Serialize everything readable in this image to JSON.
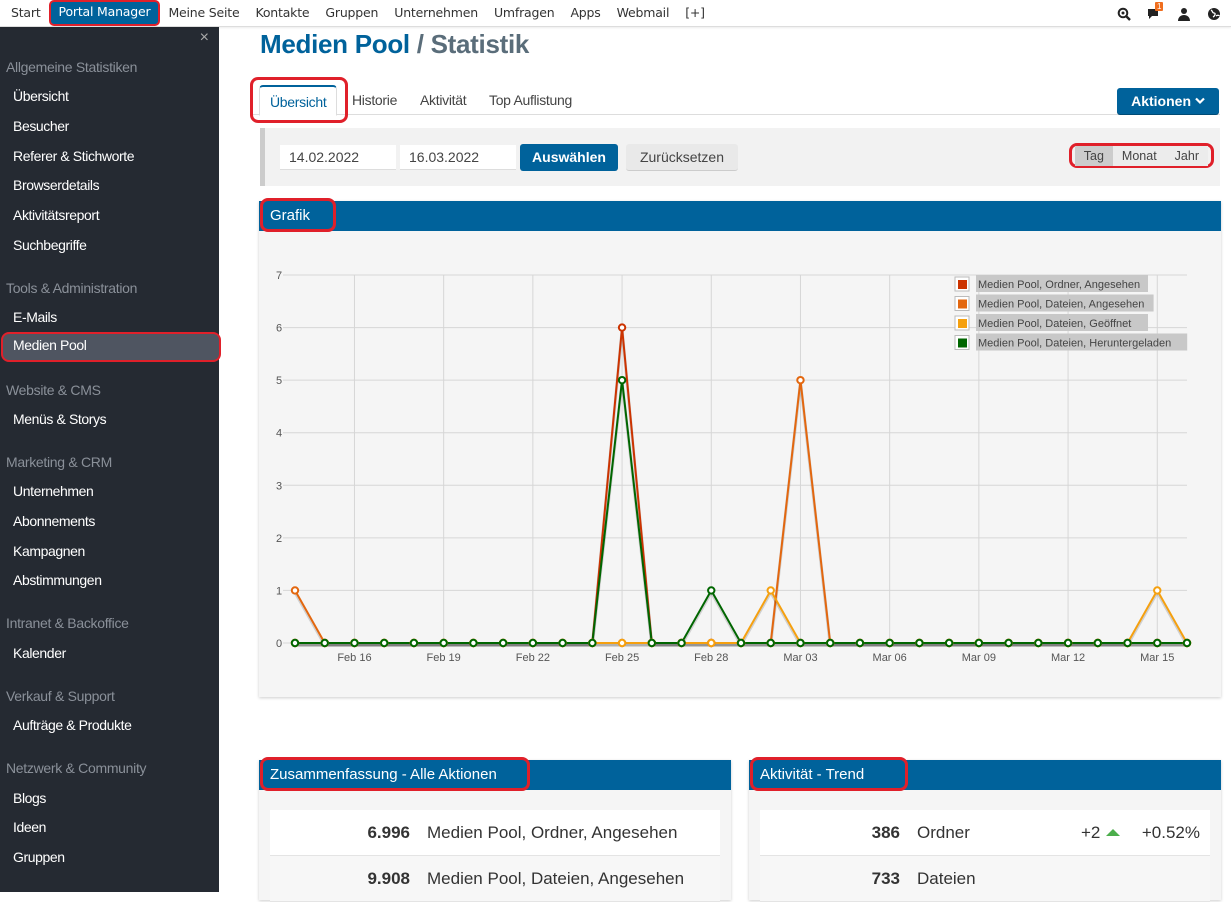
{
  "topnav": {
    "items": [
      "Start",
      "Portal Manager",
      "Meine Seite",
      "Kontakte",
      "Gruppen",
      "Unternehmen",
      "Umfragen",
      "Apps",
      "Webmail",
      "[+]"
    ],
    "active_index": 1,
    "notification_count": "1",
    "icons": [
      "zoom-search-icon",
      "chat-bubble-icon",
      "user-icon",
      "globe-icon"
    ]
  },
  "sidebar": {
    "close_label": "×",
    "groups": [
      {
        "title": "Allgemeine Statistiken",
        "items": [
          "Übersicht",
          "Besucher",
          "Referer & Stichworte",
          "Browserdetails",
          "Aktivitätsreport",
          "Suchbegriffe"
        ]
      },
      {
        "title": "Tools & Administration",
        "items": [
          "E-Mails",
          "Medien Pool"
        ]
      },
      {
        "title": "Website & CMS",
        "items": [
          "Menüs & Storys"
        ]
      },
      {
        "title": "Marketing & CRM",
        "items": [
          "Unternehmen",
          "Abonnements",
          "Kampagnen",
          "Abstimmungen"
        ]
      },
      {
        "title": "Intranet & Backoffice",
        "items": [
          "Kalender"
        ]
      },
      {
        "title": "Verkauf & Support",
        "items": [
          "Aufträge & Produkte"
        ]
      },
      {
        "title": "Netzwerk & Community",
        "items": [
          "Blogs",
          "Ideen",
          "Gruppen"
        ]
      }
    ],
    "active_item": "Medien Pool"
  },
  "page": {
    "title_main": "Medien Pool",
    "title_sep": " / ",
    "title_sub": "Statistik",
    "tabs": [
      "Übersicht",
      "Historie",
      "Aktivität",
      "Top Auflistung"
    ],
    "active_tab": "Übersicht",
    "actions_label": "Aktionen",
    "actions_icon": "chevron-down-icon"
  },
  "filter": {
    "date_from": "14.02.2022",
    "date_to": "16.03.2022",
    "select_label": "Auswählen",
    "reset_label": "Zurücksetzen",
    "periods": [
      "Tag",
      "Monat",
      "Jahr"
    ],
    "active_period": "Tag"
  },
  "chart_panel": {
    "title": "Grafik"
  },
  "chart_data": {
    "type": "line",
    "title": "",
    "xlabel": "",
    "ylabel": "",
    "ylim": [
      0,
      7
    ],
    "yticks": [
      0,
      1,
      2,
      3,
      4,
      5,
      6,
      7
    ],
    "grid": true,
    "legend_position": "top-right",
    "x": [
      "Feb 14",
      "Feb 15",
      "Feb 16",
      "Feb 17",
      "Feb 18",
      "Feb 19",
      "Feb 20",
      "Feb 21",
      "Feb 22",
      "Feb 23",
      "Feb 24",
      "Feb 25",
      "Feb 26",
      "Feb 27",
      "Feb 28",
      "Mar 01",
      "Mar 02",
      "Mar 03",
      "Mar 04",
      "Mar 05",
      "Mar 06",
      "Mar 07",
      "Mar 08",
      "Mar 09",
      "Mar 10",
      "Mar 11",
      "Mar 12",
      "Mar 13",
      "Mar 14",
      "Mar 15",
      "Mar 16"
    ],
    "xtick_labels": [
      "Feb 16",
      "Feb 19",
      "Feb 22",
      "Feb 25",
      "Feb 28",
      "Mar 03",
      "Mar 06",
      "Mar 09",
      "Mar 12",
      "Mar 15"
    ],
    "series": [
      {
        "name": "Medien Pool, Ordner, Angesehen",
        "color": "#cc3300",
        "values": [
          0,
          0,
          0,
          0,
          0,
          0,
          0,
          0,
          0,
          0,
          0,
          6,
          0,
          0,
          0,
          0,
          0,
          0,
          0,
          0,
          0,
          0,
          0,
          0,
          0,
          0,
          0,
          0,
          0,
          0,
          0
        ]
      },
      {
        "name": "Medien Pool, Dateien, Angesehen",
        "color": "#e3670f",
        "values": [
          1,
          0,
          0,
          0,
          0,
          0,
          0,
          0,
          0,
          0,
          0,
          0,
          0,
          0,
          0,
          0,
          0,
          5,
          0,
          0,
          0,
          0,
          0,
          0,
          0,
          0,
          0,
          0,
          0,
          0,
          0
        ]
      },
      {
        "name": "Medien Pool, Dateien, Geöffnet",
        "color": "#f5a00f",
        "values": [
          0,
          0,
          0,
          0,
          0,
          0,
          0,
          0,
          0,
          0,
          0,
          0,
          0,
          0,
          0,
          0,
          1,
          0,
          0,
          0,
          0,
          0,
          0,
          0,
          0,
          0,
          0,
          0,
          0,
          1,
          0
        ]
      },
      {
        "name": "Medien Pool, Dateien, Heruntergeladen",
        "color": "#006600",
        "values": [
          0,
          0,
          0,
          0,
          0,
          0,
          0,
          0,
          0,
          0,
          0,
          5,
          0,
          0,
          1,
          0,
          0,
          0,
          0,
          0,
          0,
          0,
          0,
          0,
          0,
          0,
          0,
          0,
          0,
          0,
          0
        ]
      }
    ]
  },
  "summary": {
    "title": "Zusammenfassung - Alle Aktionen",
    "rows": [
      {
        "value": "6.996",
        "label": "Medien Pool, Ordner, Angesehen"
      },
      {
        "value": "9.908",
        "label": "Medien Pool, Dateien, Angesehen"
      }
    ]
  },
  "trend": {
    "title": "Aktivität - Trend",
    "rows": [
      {
        "value": "386",
        "label": "Ordner",
        "delta": "+2",
        "direction": "up",
        "percent": "+0.52%"
      },
      {
        "value": "733",
        "label": "Dateien",
        "delta": "",
        "direction": "",
        "percent": ""
      }
    ]
  },
  "colors": {
    "brand": "#00629b",
    "sidebar_bg": "#252a32",
    "highlight": "#e0202a",
    "trend_up": "#4cae4c"
  }
}
